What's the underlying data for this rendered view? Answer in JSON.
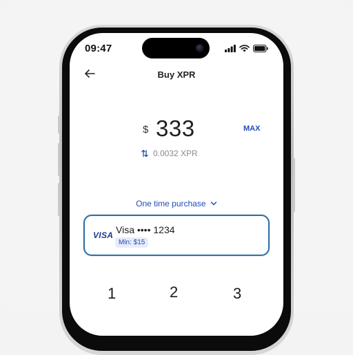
{
  "status_bar": {
    "time": "09:47"
  },
  "header": {
    "title": "Buy XPR"
  },
  "amount": {
    "currency_symbol": "$",
    "value": "333",
    "max_label": "MAX",
    "conversion": "0.0032 XPR"
  },
  "purchase": {
    "type_label": "One time purchase"
  },
  "payment_method": {
    "brand": "VISA",
    "label": "Visa •••• 1234",
    "min_label": "Min: $15"
  },
  "keypad": {
    "keys": [
      "1",
      "2",
      "3"
    ]
  },
  "colors": {
    "accent": "#2349b8",
    "card_border": "#2f6fa6"
  }
}
